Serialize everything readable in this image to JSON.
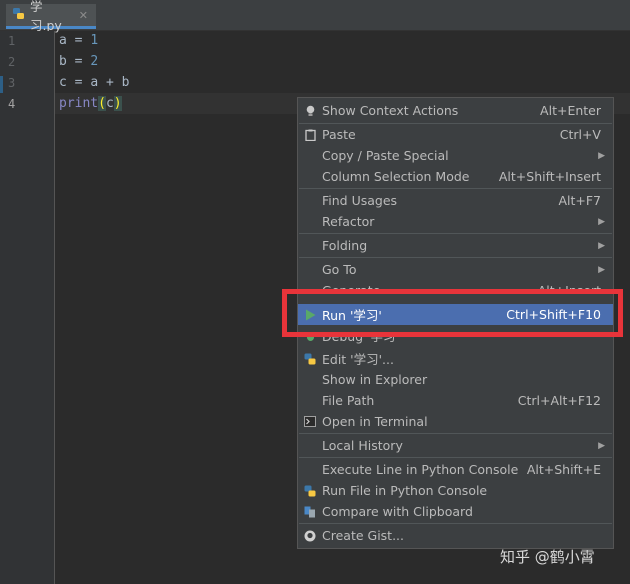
{
  "tab": {
    "filename": "学习.py",
    "icon": "python-file-icon"
  },
  "editor": {
    "line_numbers": [
      "1",
      "2",
      "3",
      "4"
    ],
    "lines": [
      {
        "var": "a",
        "op": " = ",
        "value": "1"
      },
      {
        "var": "b",
        "op": " = ",
        "value": "2"
      },
      {
        "var": "c",
        "op": " = ",
        "expr": "a + b"
      },
      {
        "func": "print",
        "open": "(",
        "arg": "c",
        "close": ")"
      }
    ]
  },
  "menu": {
    "items": [
      {
        "label": "Show Context Actions",
        "shortcut": "Alt+Enter",
        "icon": "lightbulb-icon"
      },
      {
        "label": "Paste",
        "shortcut": "Ctrl+V",
        "icon": "clipboard-icon"
      },
      {
        "label": "Copy / Paste Special",
        "submenu": true
      },
      {
        "label": "Column Selection Mode",
        "shortcut": "Alt+Shift+Insert"
      },
      {
        "label": "Find Usages",
        "shortcut": "Alt+F7"
      },
      {
        "label": "Refactor",
        "submenu": true
      },
      {
        "label": "Folding",
        "submenu": true
      },
      {
        "label": "Go To",
        "submenu": true
      },
      {
        "label": "Generate...",
        "shortcut": "Alt+Insert"
      },
      {
        "label": "Run '学习'",
        "shortcut": "Ctrl+Shift+F10",
        "icon": "run-icon",
        "selected": true
      },
      {
        "label": "Debug '学习'",
        "icon": "debug-icon"
      },
      {
        "label": "Edit '学习'...",
        "icon": "python-icon"
      },
      {
        "label": "Show in Explorer"
      },
      {
        "label": "File Path",
        "shortcut": "Ctrl+Alt+F12"
      },
      {
        "label": "Open in Terminal",
        "icon": "terminal-icon"
      },
      {
        "label": "Local History",
        "submenu": true
      },
      {
        "label": "Execute Line in Python Console",
        "shortcut": "Alt+Shift+E"
      },
      {
        "label": "Run File in Python Console",
        "icon": "python-icon"
      },
      {
        "label": "Compare with Clipboard",
        "icon": "compare-icon"
      },
      {
        "label": "Create Gist...",
        "icon": "github-icon"
      }
    ]
  },
  "colors": {
    "highlight_box": "#e8343a",
    "selection": "#4b6eaf"
  },
  "watermark": "知乎 @鹤小霄"
}
